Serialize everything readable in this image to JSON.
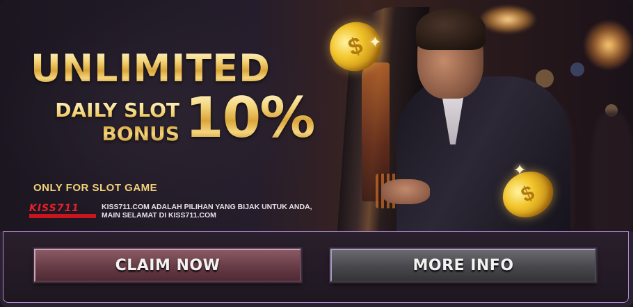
{
  "banner": {
    "headline": "UNLIMITED",
    "subline_1": "DAILY SLOT",
    "subline_2": "BONUS",
    "percent": "10%",
    "note": "ONLY FOR SLOT GAME",
    "logo": "KISS711",
    "tagline_1": "KISS711.COM ADALAH PILIHAN YANG BIJAK UNTUK ANDA,",
    "tagline_2": "MAIN SELAMAT DI KISS711.COM"
  },
  "actions": {
    "claim_label": "CLAIM NOW",
    "info_label": "MORE INFO"
  },
  "colors": {
    "gold": "#e8b84a",
    "logo_red": "#e7202a",
    "frame_purple": "#b48ad6"
  }
}
